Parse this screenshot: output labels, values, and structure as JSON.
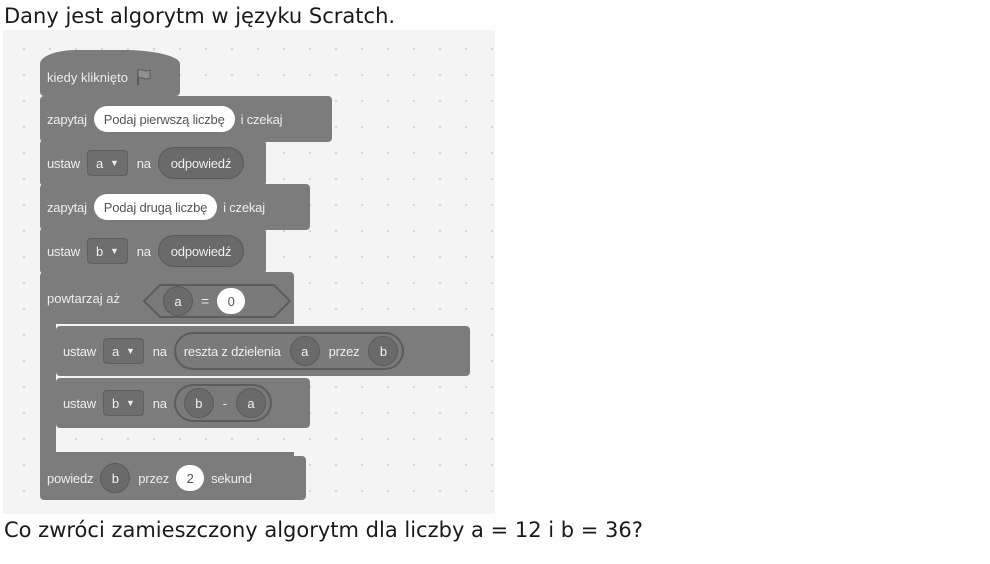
{
  "intro_text": "Dany jest algorytm w języku Scratch.",
  "question_text": "Co zwróci zamieszczony algorytm dla liczby a = 12 i b = 36?",
  "script": {
    "hat": {
      "label": "kiedy kliknięto",
      "icon": "green-flag-icon"
    },
    "ask1": {
      "word": "zapytaj",
      "input": "Podaj pierwszą liczbę",
      "suffix": "i czekaj"
    },
    "set1": {
      "word": "ustaw",
      "var": "a",
      "na": "na",
      "value": "odpowiedź"
    },
    "ask2": {
      "word": "zapytaj",
      "input": "Podaj drugą liczbę",
      "suffix": "i czekaj"
    },
    "set2": {
      "word": "ustaw",
      "var": "b",
      "na": "na",
      "value": "odpowiedź"
    },
    "repeat": {
      "label": "powtarzaj aż",
      "cond_left": "a",
      "cond_op": "=",
      "cond_right": "0",
      "loop_icon": "loop-arrow-icon"
    },
    "inner1": {
      "word": "ustaw",
      "var": "a",
      "na": "na",
      "op_label": "reszta z dzielenia",
      "op_a": "a",
      "op_mid": "przez",
      "op_b": "b"
    },
    "inner2": {
      "word": "ustaw",
      "var": "b",
      "na": "na",
      "op_a": "b",
      "op_mid": "-",
      "op_b": "a"
    },
    "say": {
      "word": "powiedz",
      "var": "b",
      "przez": "przez",
      "secs": "2",
      "suffix": "sekund"
    }
  },
  "colors": {
    "block": "#7c7c7c",
    "reporter": "#6a6a6a",
    "canvas": "#f4f4f4"
  }
}
